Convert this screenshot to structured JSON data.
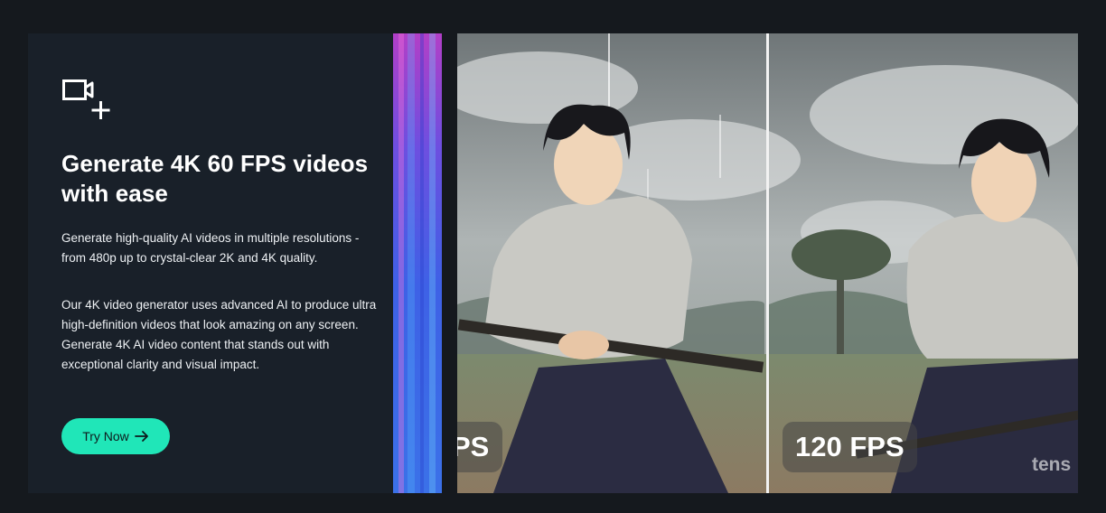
{
  "feature": {
    "headline": "Generate 4K 60 FPS videos with ease",
    "paragraph_1": "Generate high-quality AI videos in multiple resolutions - from 480p up to crystal-clear 2K and 4K quality.",
    "paragraph_2": "Our 4K video generator uses advanced AI to produce ultra high-definition videos that look amazing on any screen. Generate 4K AI video content that stands out with exceptional clarity and visual impact.",
    "cta_label": "Try Now",
    "cta_icon": "arrow-right-icon",
    "top_icon": "video-add-icon"
  },
  "comparison": {
    "left_badge": "PS",
    "right_badge": "120 FPS",
    "watermark": "tens"
  },
  "colors": {
    "accent": "#20e6b8",
    "panel": "#192029",
    "background": "#15191e"
  }
}
